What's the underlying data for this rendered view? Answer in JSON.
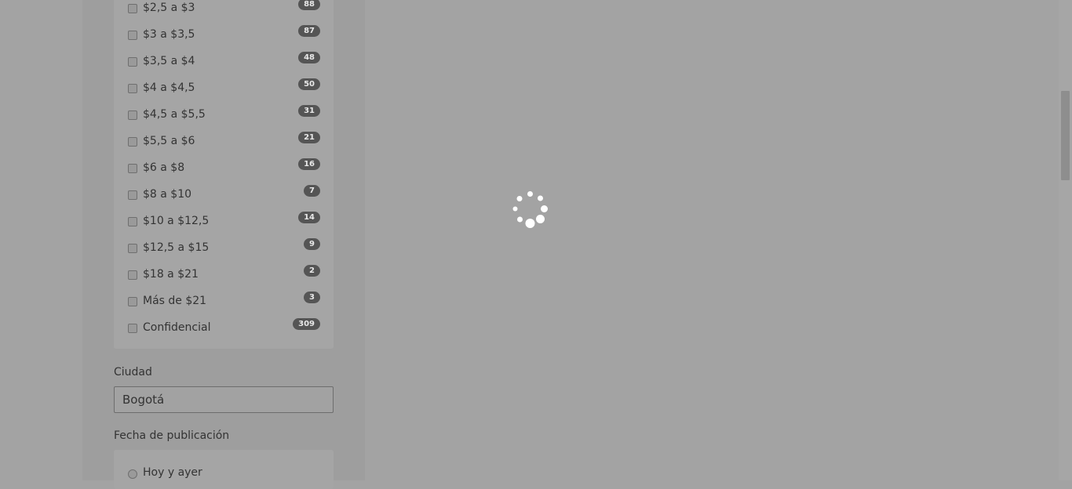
{
  "salary_filter": {
    "items": [
      {
        "label": "$2,5 a $3",
        "count": "88"
      },
      {
        "label": "$3 a $3,5",
        "count": "87"
      },
      {
        "label": "$3,5 a $4",
        "count": "48"
      },
      {
        "label": "$4 a $4,5",
        "count": "50"
      },
      {
        "label": "$4,5 a $5,5",
        "count": "31"
      },
      {
        "label": "$5,5 a $6",
        "count": "21"
      },
      {
        "label": "$6 a $8",
        "count": "16"
      },
      {
        "label": "$8 a $10",
        "count": "7"
      },
      {
        "label": "$10 a $12,5",
        "count": "14"
      },
      {
        "label": "$12,5 a $15",
        "count": "9"
      },
      {
        "label": "$18 a $21",
        "count": "2"
      },
      {
        "label": "Más de $21",
        "count": "3"
      },
      {
        "label": "Confidencial",
        "count": "309"
      }
    ]
  },
  "city_filter": {
    "label": "Ciudad",
    "value": "Bogotá"
  },
  "date_filter": {
    "label": "Fecha de publicación",
    "options": [
      {
        "label": "Hoy y ayer"
      }
    ]
  },
  "loading": {
    "spinner_icon": "loading-spinner-icon"
  },
  "colors": {
    "overlay_gray": "#a3a3a3",
    "badge": "#555555"
  }
}
